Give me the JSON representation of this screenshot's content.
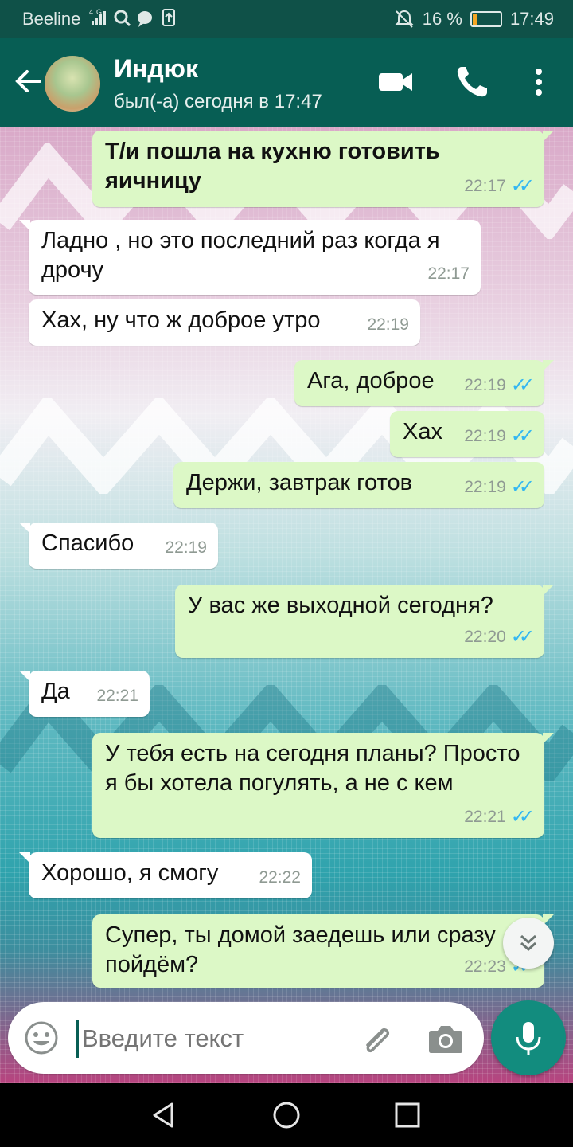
{
  "status_bar": {
    "carrier": "Beeline",
    "network": "4G",
    "battery": "16 %",
    "battery_level": 0.16,
    "time": "17:49"
  },
  "header": {
    "contact_name": "Индюк",
    "last_seen": "был(-а) сегодня в 17:47",
    "icons": [
      "back-arrow-icon",
      "video-call-icon",
      "phone-icon",
      "more-vert-icon"
    ]
  },
  "messages": [
    {
      "dir": "out",
      "text": "Т/и пошла на кухню готовить яичницу",
      "time": "22:17",
      "read": true,
      "bold": true
    },
    {
      "dir": "in",
      "text": "Ладно , но это последний раз когда я дрочу",
      "time": "22:17"
    },
    {
      "dir": "in",
      "text": "Хах, ну что ж доброе утро",
      "time": "22:19"
    },
    {
      "dir": "out",
      "text": "Ага, доброе",
      "time": "22:19",
      "read": true
    },
    {
      "dir": "out",
      "text": "Хах",
      "time": "22:19",
      "read": true
    },
    {
      "dir": "out",
      "text": "Держи, завтрак готов",
      "time": "22:19",
      "read": true
    },
    {
      "dir": "in",
      "text": "Спасибо",
      "time": "22:19"
    },
    {
      "dir": "out",
      "text": "У вас же выходной сегодня?",
      "time": "22:20",
      "read": true
    },
    {
      "dir": "in",
      "text": "Да",
      "time": "22:21"
    },
    {
      "dir": "out",
      "text": "У тебя есть на сегодня планы? Просто я бы хотела погулять, а не с кем",
      "time": "22:21",
      "read": true
    },
    {
      "dir": "in",
      "text": "Хорошо, я смогу",
      "time": "22:22"
    },
    {
      "dir": "out",
      "text": "Супер, ты домой заедешь или сразу пойдём?",
      "time": "22:23",
      "read": true
    }
  ],
  "composer": {
    "placeholder": "Введите текст"
  },
  "colors": {
    "header": "#075e54",
    "status_bar": "#0f5148",
    "outgoing_bubble": "#dcf8c6",
    "incoming_bubble": "#ffffff",
    "read_ticks": "#34b7f1",
    "mic_button": "#128c7e"
  }
}
